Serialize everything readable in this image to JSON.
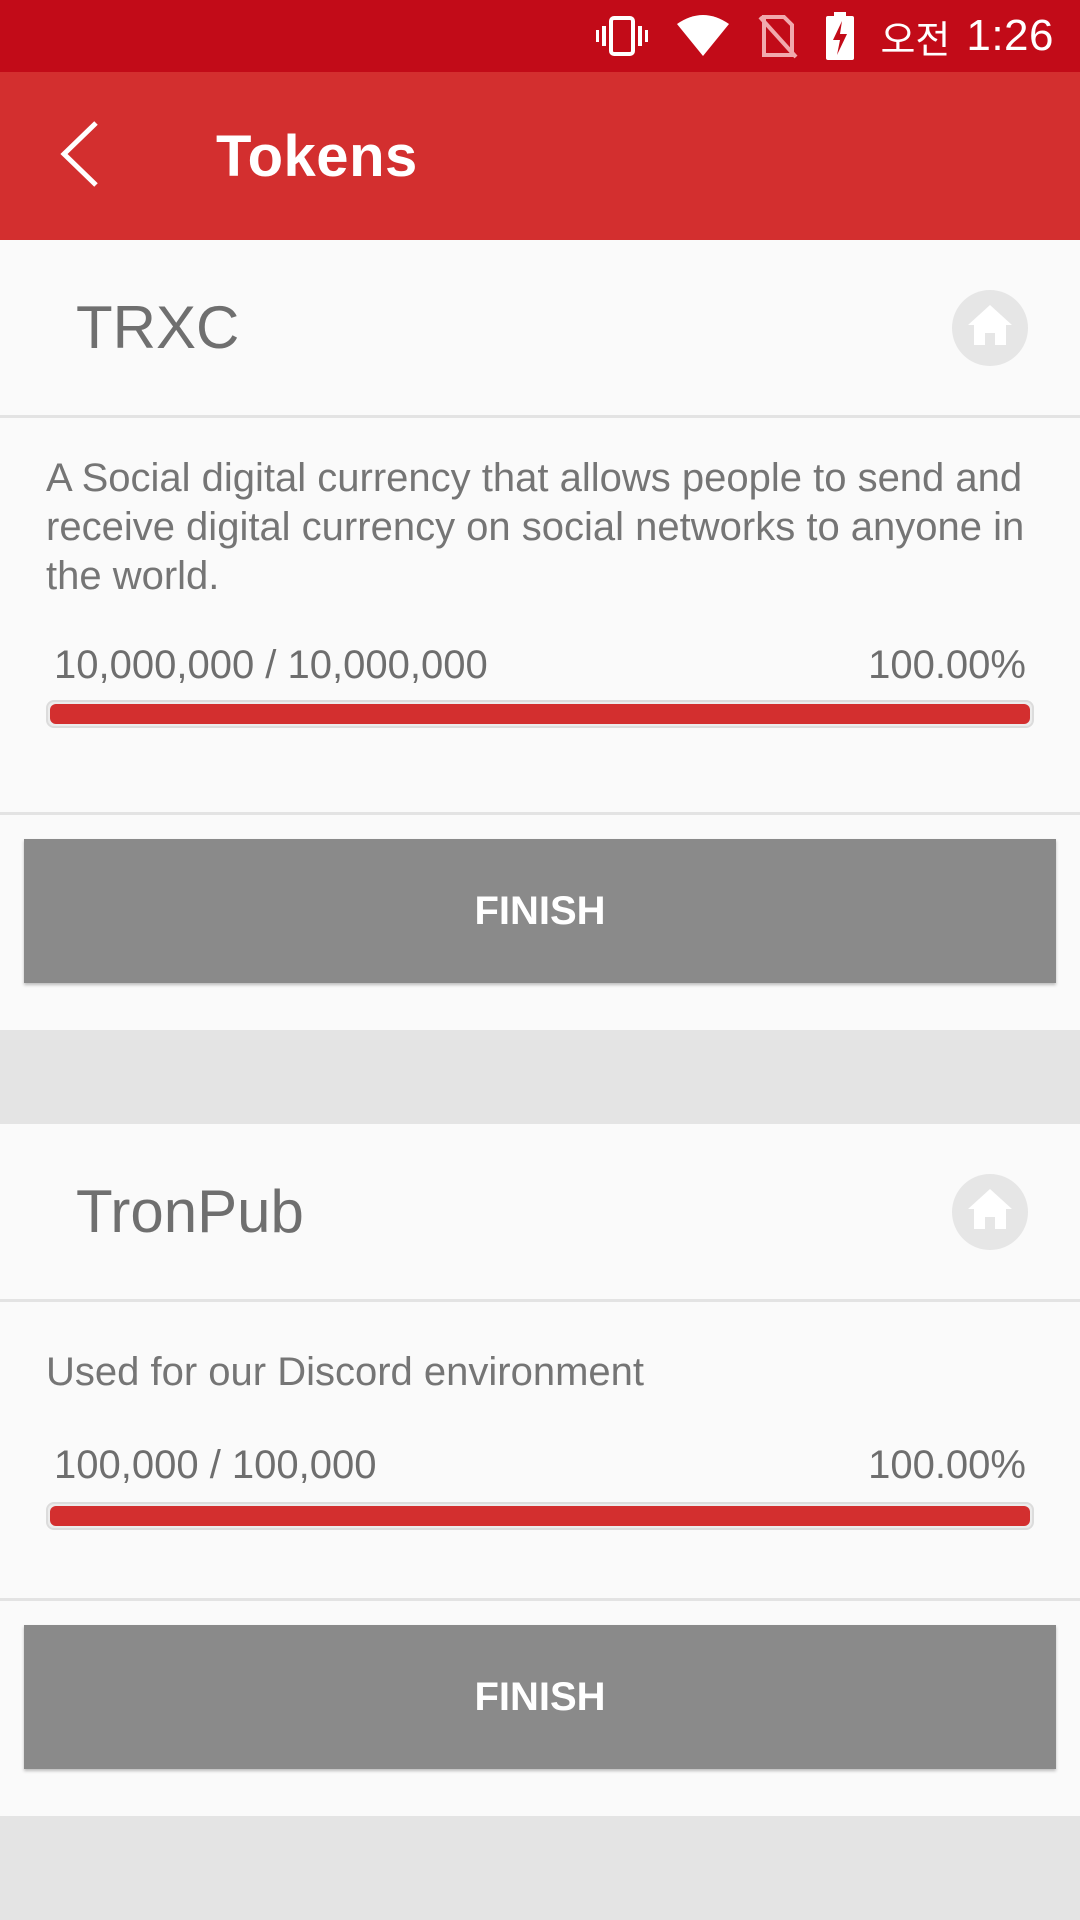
{
  "status_bar": {
    "ampm": "오전",
    "time": "1:26",
    "icons": [
      "vibrate-icon",
      "wifi-icon",
      "no-sim-icon",
      "battery-charging-icon"
    ]
  },
  "toolbar": {
    "back_icon": "chevron-left-icon",
    "title": "Tokens"
  },
  "tokens": [
    {
      "name": "TRXC",
      "home_icon": "home-icon",
      "description": "A Social digital currency that allows people to send and receive digital currency on social networks to anyone in the world.",
      "progress_text": "10,000,000 / 10,000,000",
      "percent_text": "100.00%",
      "progress_fraction": 1.0,
      "button_label": "FINISH"
    },
    {
      "name": "TronPub",
      "home_icon": "home-icon",
      "description": "Used for our Discord environment",
      "progress_text": "100,000 / 100,000",
      "percent_text": "100.00%",
      "progress_fraction": 1.0,
      "button_label": "FINISH"
    }
  ],
  "colors": {
    "status_bar": "#c20b18",
    "toolbar": "#d32f2f",
    "progress": "#d32f2f",
    "finish_button": "#8a8a8a",
    "background": "#e4e4e4"
  }
}
